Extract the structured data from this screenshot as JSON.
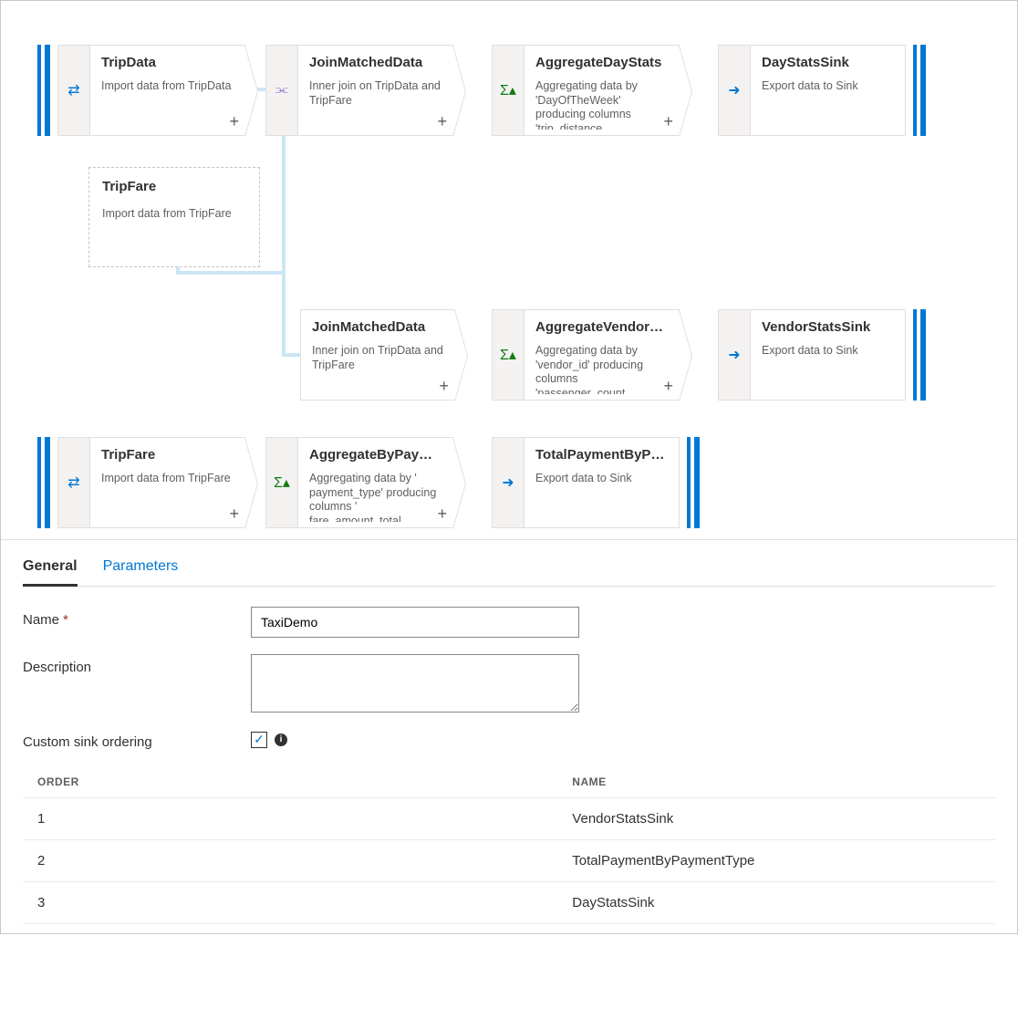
{
  "icons": {
    "source": "⇄",
    "join": "⫘",
    "agg": "Σ▴",
    "sink": "➜"
  },
  "flow": {
    "tripdata": {
      "title": "TripData",
      "desc": "Import data from TripData"
    },
    "tripfare_g": {
      "title": "TripFare",
      "desc": "Import data from TripFare"
    },
    "join1": {
      "title": "JoinMatchedData",
      "desc": "Inner join on TripData and TripFare"
    },
    "aggday": {
      "title": "AggregateDayStats",
      "desc": "Aggregating data by 'DayOfTheWeek' producing columns 'trip_distance…"
    },
    "daysink": {
      "title": "DayStatsSink",
      "desc": "Export data to Sink"
    },
    "join2": {
      "title": "JoinMatchedData",
      "desc": "Inner join on TripData and TripFare"
    },
    "aggvend": {
      "title": "AggregateVendorS...",
      "desc": "Aggregating data by 'vendor_id' producing columns 'passenger_count…"
    },
    "vendsink": {
      "title": "VendorStatsSink",
      "desc": "Export data to Sink"
    },
    "tripfare": {
      "title": "TripFare",
      "desc": "Import data from TripFare"
    },
    "aggpay": {
      "title": "AggregateByPaym...",
      "desc": "Aggregating data by ' payment_type' producing columns ' fare_amount_total…"
    },
    "paysink": {
      "title": "TotalPaymentByPa...",
      "desc": "Export data to Sink"
    }
  },
  "tabs": {
    "general": "General",
    "parameters": "Parameters"
  },
  "form": {
    "name_label": "Name",
    "name_value": "TaxiDemo",
    "desc_label": "Description",
    "desc_value": "",
    "custom_label": "Custom sink ordering",
    "custom_checked": true
  },
  "order_table": {
    "headers": {
      "order": "ORDER",
      "name": "NAME"
    },
    "rows": [
      {
        "order": "1",
        "name": "VendorStatsSink"
      },
      {
        "order": "2",
        "name": "TotalPaymentByPaymentType"
      },
      {
        "order": "3",
        "name": "DayStatsSink"
      }
    ]
  }
}
